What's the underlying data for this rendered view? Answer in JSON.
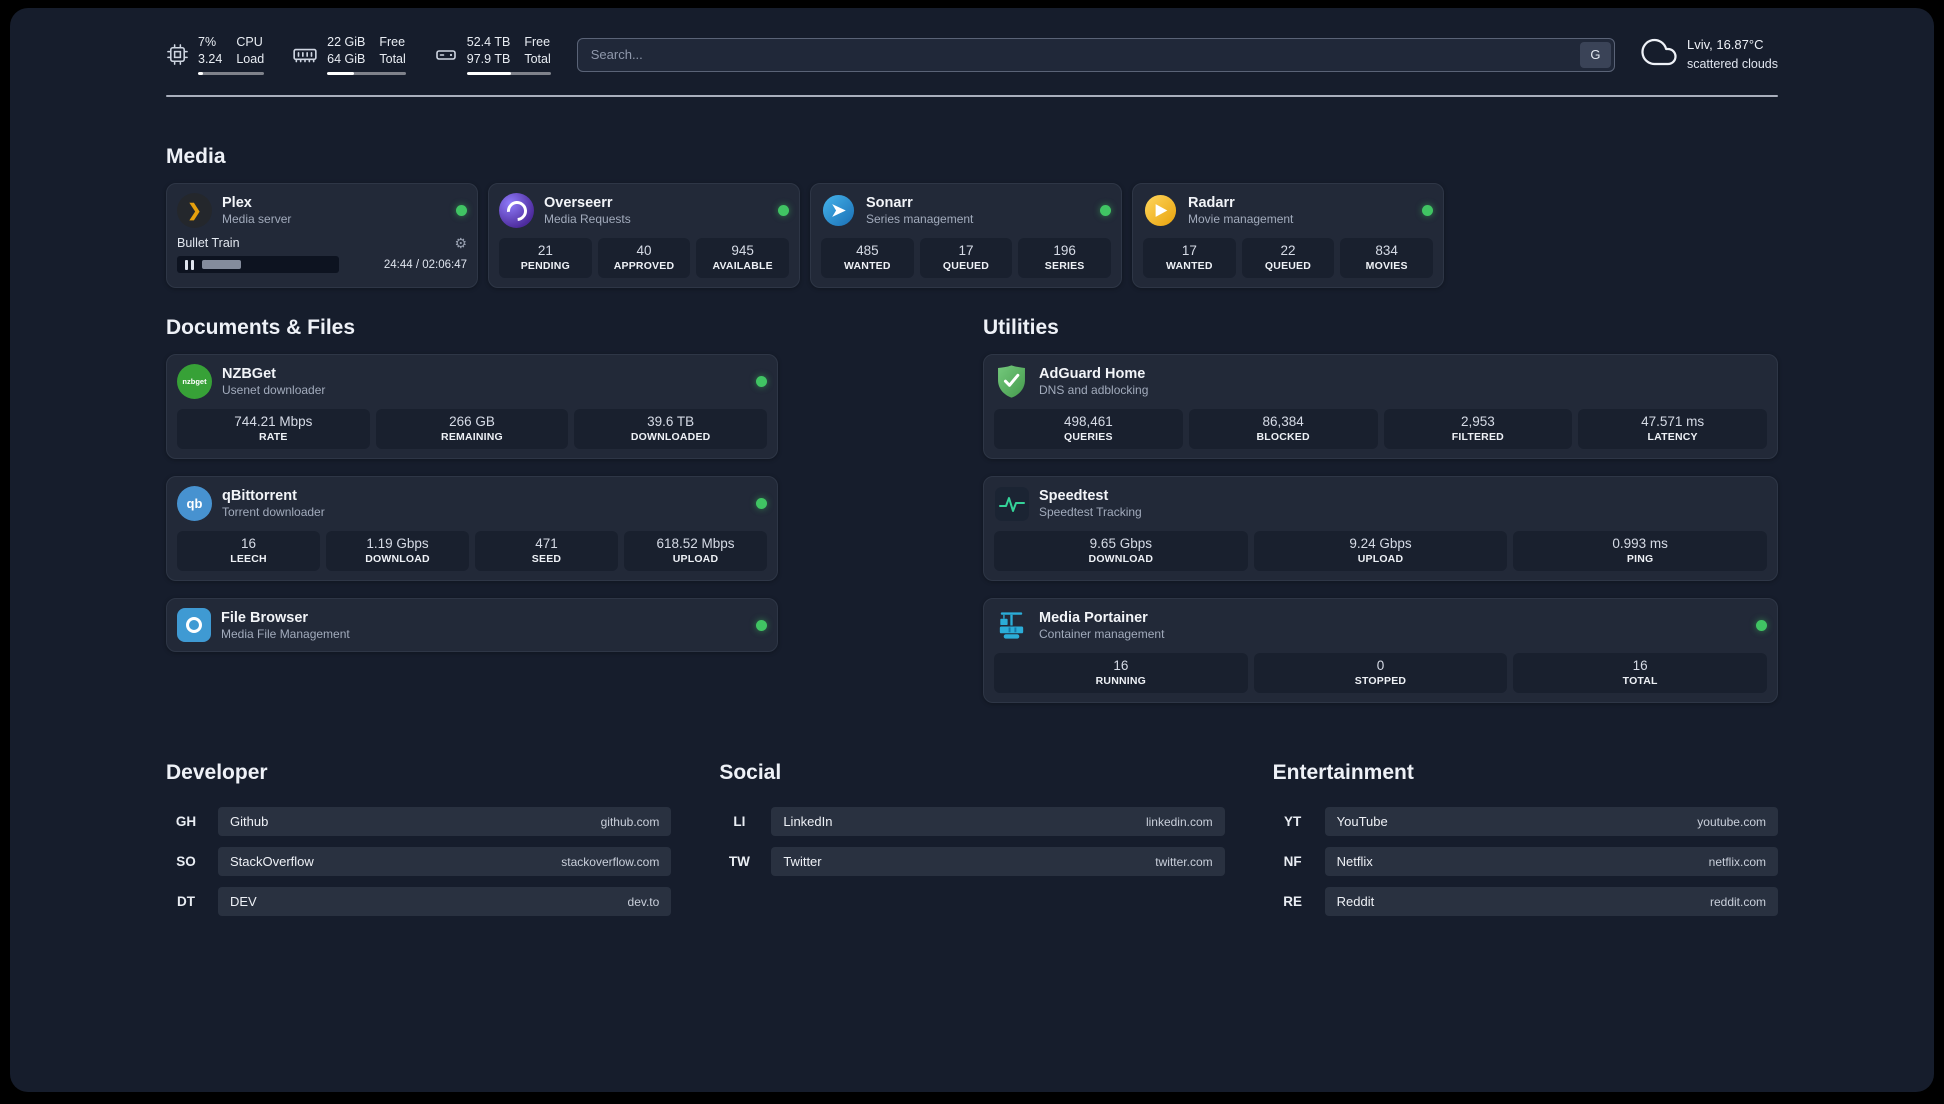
{
  "colors": {
    "status_online": "#40c463",
    "plex_accent": "#e5a00d"
  },
  "icons": {
    "plex_chevron": "❯",
    "gear": "⚙",
    "nzbget_text": "nzbget",
    "qbit_text": "qb"
  },
  "header": {
    "cpu": {
      "values": [
        "7%",
        "3.24"
      ],
      "labels": [
        "CPU",
        "Load"
      ]
    },
    "ram": {
      "values": [
        "22 GiB",
        "64 GiB"
      ],
      "labels": [
        "Free",
        "Total"
      ]
    },
    "disk": {
      "values": [
        "52.4 TB",
        "97.9 TB"
      ],
      "labels": [
        "Free",
        "Total"
      ]
    },
    "search": {
      "placeholder": "Search...",
      "engine_button": "G"
    },
    "weather": {
      "location": "Lviv, 16.87°C",
      "condition": "scattered clouds"
    }
  },
  "media": {
    "title": "Media",
    "plex": {
      "name": "Plex",
      "subtitle": "Media server",
      "now_playing": "Bullet Train",
      "time": "24:44 / 02:06:47"
    },
    "overseerr": {
      "name": "Overseerr",
      "subtitle": "Media Requests",
      "stats": [
        {
          "value": "21",
          "label": "PENDING"
        },
        {
          "value": "40",
          "label": "APPROVED"
        },
        {
          "value": "945",
          "label": "AVAILABLE"
        }
      ]
    },
    "sonarr": {
      "name": "Sonarr",
      "subtitle": "Series management",
      "stats": [
        {
          "value": "485",
          "label": "WANTED"
        },
        {
          "value": "17",
          "label": "QUEUED"
        },
        {
          "value": "196",
          "label": "SERIES"
        }
      ]
    },
    "radarr": {
      "name": "Radarr",
      "subtitle": "Movie management",
      "stats": [
        {
          "value": "17",
          "label": "WANTED"
        },
        {
          "value": "22",
          "label": "QUEUED"
        },
        {
          "value": "834",
          "label": "MOVIES"
        }
      ]
    }
  },
  "documents": {
    "title": "Documents & Files",
    "nzbget": {
      "name": "NZBGet",
      "subtitle": "Usenet downloader",
      "stats": [
        {
          "value": "744.21 Mbps",
          "label": "RATE"
        },
        {
          "value": "266 GB",
          "label": "REMAINING"
        },
        {
          "value": "39.6 TB",
          "label": "DOWNLOADED"
        }
      ]
    },
    "qbittorrent": {
      "name": "qBittorrent",
      "subtitle": "Torrent downloader",
      "stats": [
        {
          "value": "16",
          "label": "LEECH"
        },
        {
          "value": "1.19 Gbps",
          "label": "DOWNLOAD"
        },
        {
          "value": "471",
          "label": "SEED"
        },
        {
          "value": "618.52 Mbps",
          "label": "UPLOAD"
        }
      ]
    },
    "filebrowser": {
      "name": "File Browser",
      "subtitle": "Media File Management"
    }
  },
  "utilities": {
    "title": "Utilities",
    "adguard": {
      "name": "AdGuard Home",
      "subtitle": "DNS and adblocking",
      "stats": [
        {
          "value": "498,461",
          "label": "QUERIES"
        },
        {
          "value": "86,384",
          "label": "BLOCKED"
        },
        {
          "value": "2,953",
          "label": "FILTERED"
        },
        {
          "value": "47.571 ms",
          "label": "LATENCY"
        }
      ]
    },
    "speedtest": {
      "name": "Speedtest",
      "subtitle": "Speedtest Tracking",
      "stats": [
        {
          "value": "9.65 Gbps",
          "label": "DOWNLOAD"
        },
        {
          "value": "9.24 Gbps",
          "label": "UPLOAD"
        },
        {
          "value": "0.993 ms",
          "label": "PING"
        }
      ]
    },
    "portainer": {
      "name": "Media Portainer",
      "subtitle": "Container management",
      "stats": [
        {
          "value": "16",
          "label": "RUNNING"
        },
        {
          "value": "0",
          "label": "STOPPED"
        },
        {
          "value": "16",
          "label": "TOTAL"
        }
      ]
    }
  },
  "links": {
    "developer": {
      "title": "Developer",
      "items": [
        {
          "abbr": "GH",
          "name": "Github",
          "url": "github.com"
        },
        {
          "abbr": "SO",
          "name": "StackOverflow",
          "url": "stackoverflow.com"
        },
        {
          "abbr": "DT",
          "name": "DEV",
          "url": "dev.to"
        }
      ]
    },
    "social": {
      "title": "Social",
      "items": [
        {
          "abbr": "LI",
          "name": "LinkedIn",
          "url": "linkedin.com"
        },
        {
          "abbr": "TW",
          "name": "Twitter",
          "url": "twitter.com"
        }
      ]
    },
    "entertainment": {
      "title": "Entertainment",
      "items": [
        {
          "abbr": "YT",
          "name": "YouTube",
          "url": "youtube.com"
        },
        {
          "abbr": "NF",
          "name": "Netflix",
          "url": "netflix.com"
        },
        {
          "abbr": "RE",
          "name": "Reddit",
          "url": "reddit.com"
        }
      ]
    }
  }
}
